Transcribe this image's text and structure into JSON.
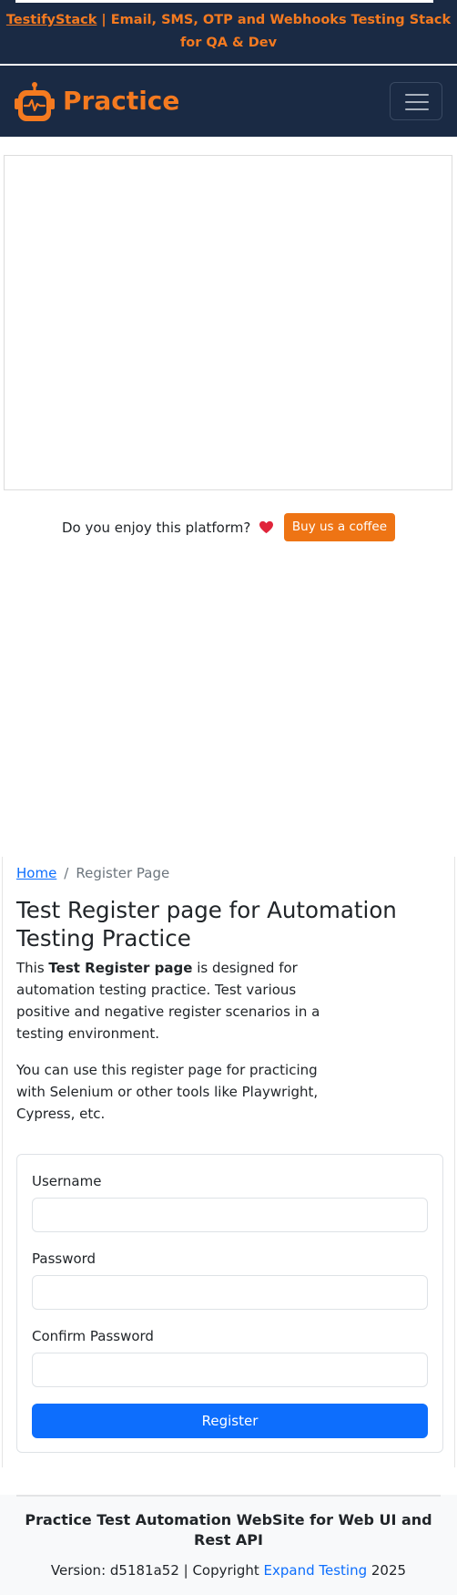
{
  "promo": {
    "link_text": "TestifyStack",
    "text": " | Email, SMS, OTP and Webhooks Testing Stack for QA & Dev"
  },
  "navbar": {
    "brand": "Practice",
    "logo_icon": "robot-icon",
    "toggler_icon": "hamburger-icon"
  },
  "support": {
    "question": "Do you enjoy this platform?",
    "heart_icon": "heart-icon",
    "button_label": "Buy us a coffee"
  },
  "breadcrumb": {
    "home": "Home",
    "separator": "/",
    "current": "Register Page"
  },
  "main": {
    "title": "Test Register page for Automation Testing Practice",
    "intro_prefix": "This ",
    "intro_bold": "Test Register page",
    "intro_suffix": " is designed for automation testing practice. Test various positive and negative register scenarios in a testing environment.",
    "intro2": "You can use this register page for practicing with Selenium or other tools like Playwright, Cypress, etc."
  },
  "form": {
    "username_label": "Username",
    "username_value": "",
    "password_label": "Password",
    "password_value": "",
    "confirm_label": "Confirm Password",
    "confirm_value": "",
    "submit_label": "Register"
  },
  "footer": {
    "title": "Practice Test Automation WebSite for Web UI and Rest API",
    "version_prefix": "Version: d5181a52 | Copyright ",
    "link_text": "Expand Testing",
    "version_suffix": " 2025"
  },
  "colors": {
    "navy": "#1a2a44",
    "orange": "#f47a20",
    "coffee_button": "#ee7414",
    "primary": "#0d6efd"
  }
}
